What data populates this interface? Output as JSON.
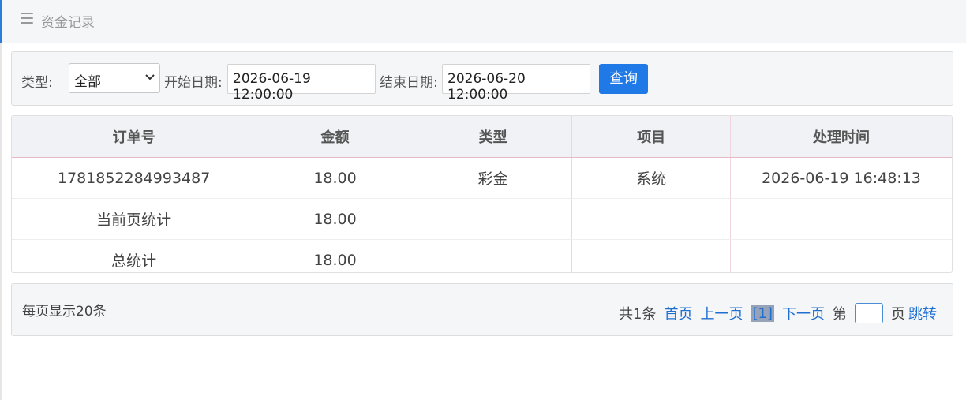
{
  "header": {
    "title": "资金记录",
    "icon": "menu-icon"
  },
  "filter": {
    "type_label": "类型:",
    "type_value": "全部",
    "start_label": "开始日期:",
    "start_value": "2026-06-19 12:00:00",
    "end_label": "结束日期:",
    "end_value": "2026-06-20 12:00:00",
    "query_label": "查询"
  },
  "table": {
    "columns": [
      "订单号",
      "金额",
      "类型",
      "项目",
      "处理时间"
    ],
    "rows": [
      [
        "1781852284993487",
        "18.00",
        "彩金",
        "系统",
        "2026-06-19 16:48:13"
      ],
      [
        "当前页统计",
        "18.00",
        "",
        "",
        ""
      ],
      [
        "总统计",
        "18.00",
        "",
        "",
        ""
      ]
    ]
  },
  "pagination": {
    "per_page": "每页显示20条",
    "total": "共1条",
    "first": "首页",
    "prev": "上一页",
    "current": "[1]",
    "next": "下一页",
    "goto_prefix": "第",
    "goto_suffix": "页",
    "jump": "跳转"
  },
  "colors": {
    "accent": "#1f7ae8",
    "link": "#1f6fd1",
    "panel_bg": "#f5f6f8"
  }
}
